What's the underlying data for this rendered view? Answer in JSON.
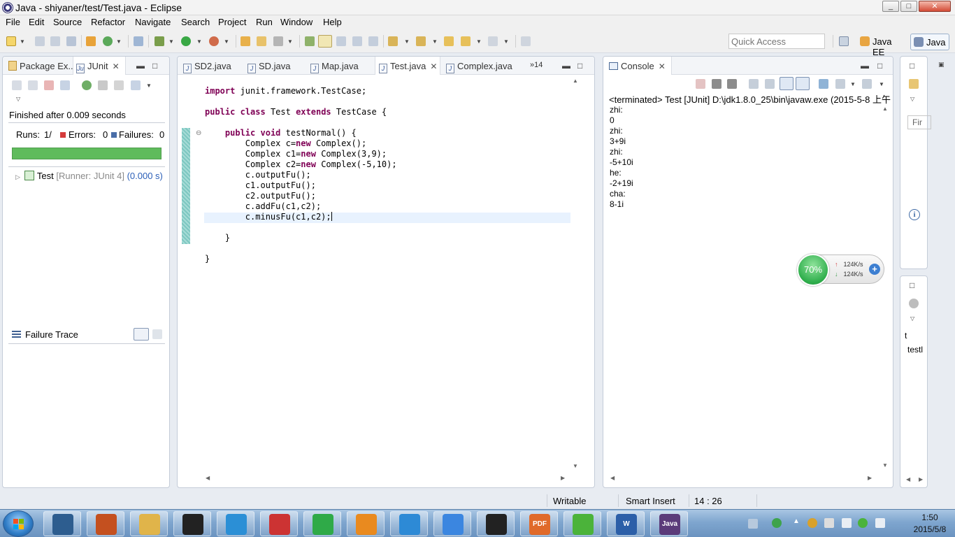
{
  "window": {
    "title": "Java - shiyaner/test/Test.java - Eclipse",
    "min": "_",
    "max": "□",
    "close": "✕"
  },
  "menu": [
    "File",
    "Edit",
    "Source",
    "Refactor",
    "Navigate",
    "Search",
    "Project",
    "Run",
    "Window",
    "Help"
  ],
  "toolbar": {
    "quick_access_placeholder": "Quick Access",
    "perspective_javaee": "Java EE",
    "perspective_java": "Java"
  },
  "junit_view": {
    "tab_package_explorer": "Package Ex...",
    "tab_junit": "JUnit",
    "finished": "Finished after 0.009 seconds",
    "runs_label": "Runs:",
    "runs_value": "1/",
    "errors_label": "Errors:",
    "errors_value": "0",
    "failures_label": "Failures:",
    "failures_value": "0",
    "progress": 1.0,
    "progress_color": "#5fbb5c",
    "test_name": "Test",
    "test_runner": "[Runner: JUnit 4]",
    "test_time": "(0.000 s)",
    "failure_trace": "Failure Trace"
  },
  "editor": {
    "tabs": [
      "SD2.java",
      "SD.java",
      "Map.java",
      "Test.java",
      "Complex.java"
    ],
    "active_tab": "Test.java",
    "overflow": "»14",
    "lines": [
      "import junit.framework.TestCase;",
      "",
      "public class Test extends TestCase {",
      "",
      "    public void testNormal() {",
      "        Complex c=new Complex();",
      "        Complex c1=new Complex(3,9);",
      "        Complex c2=new Complex(-5,10);",
      "        c.outputFu();",
      "        c1.outputFu();",
      "        c2.outputFu();",
      "        c.addFu(c1,c2);",
      "        c.minusFu(c1,c2);",
      "",
      "    }",
      "",
      "}"
    ]
  },
  "console": {
    "tab": "Console",
    "terminated": "<terminated> Test [JUnit] D:\\jdk1.8.0_25\\bin\\javaw.exe (2015-5-8 上午",
    "lines": [
      "zhi:",
      "0",
      "zhi:",
      "3+9i",
      "zhi:",
      "-5+10i",
      "he:",
      "-2+19i",
      "cha:",
      "8-1i"
    ]
  },
  "right_panel": {
    "find_placeholder": "Fir",
    "t": "t",
    "testl": "testl"
  },
  "net_widget": {
    "percent": "70%",
    "up": "124K/s",
    "down": "124K/s"
  },
  "statusbar": {
    "writable": "Writable",
    "insert_mode": "Smart Insert",
    "position": "14 : 26"
  },
  "taskbar": {
    "apps": [
      {
        "name": "monitor",
        "color": "#2d5d8f",
        "label": ""
      },
      {
        "name": "game",
        "color": "#c4501f",
        "label": ""
      },
      {
        "name": "explorer",
        "color": "#e0b44a",
        "label": ""
      },
      {
        "name": "qq",
        "color": "#222",
        "label": ""
      },
      {
        "name": "browser",
        "color": "#2b8fd6",
        "label": ""
      },
      {
        "name": "office",
        "color": "#c33",
        "label": ""
      },
      {
        "name": "refresh",
        "color": "#2faa48",
        "label": ""
      },
      {
        "name": "sogou",
        "color": "#e98a1f",
        "label": ""
      },
      {
        "name": "network",
        "color": "#2d8ad6",
        "label": ""
      },
      {
        "name": "notes",
        "color": "#3b86e0",
        "label": ""
      },
      {
        "name": "media",
        "color": "#222",
        "label": ""
      },
      {
        "name": "pdf",
        "color": "#e06a2a",
        "label": "PDF"
      },
      {
        "name": "plus-app",
        "color": "#4bb33a",
        "label": ""
      },
      {
        "name": "word",
        "color": "#2c5fa8",
        "label": "W"
      },
      {
        "name": "javaee-ide",
        "color": "#5b3b7a",
        "label": "Java EE IDE"
      }
    ],
    "clock_time": "1:50",
    "clock_date": "2015/5/8"
  }
}
